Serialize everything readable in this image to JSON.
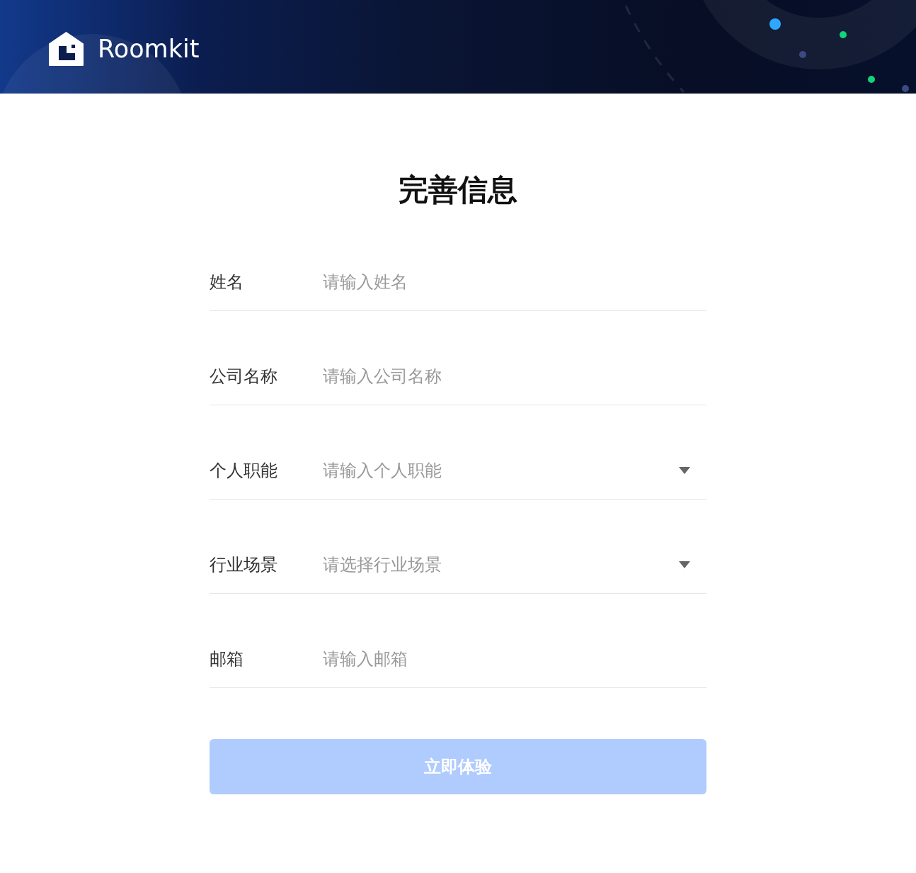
{
  "header": {
    "brand": "Roomkit"
  },
  "title": "完善信息",
  "fields": [
    {
      "kind": "text",
      "label": "姓名",
      "placeholder": "请输入姓名"
    },
    {
      "kind": "text",
      "label": "公司名称",
      "placeholder": "请输入公司名称"
    },
    {
      "kind": "select",
      "label": "个人职能",
      "placeholder": "请输入个人职能"
    },
    {
      "kind": "select",
      "label": "行业场景",
      "placeholder": "请选择行业场景"
    },
    {
      "kind": "text",
      "label": "邮箱",
      "placeholder": "请输入邮箱"
    }
  ],
  "submit": {
    "label": "立即体验",
    "disabled": true
  }
}
